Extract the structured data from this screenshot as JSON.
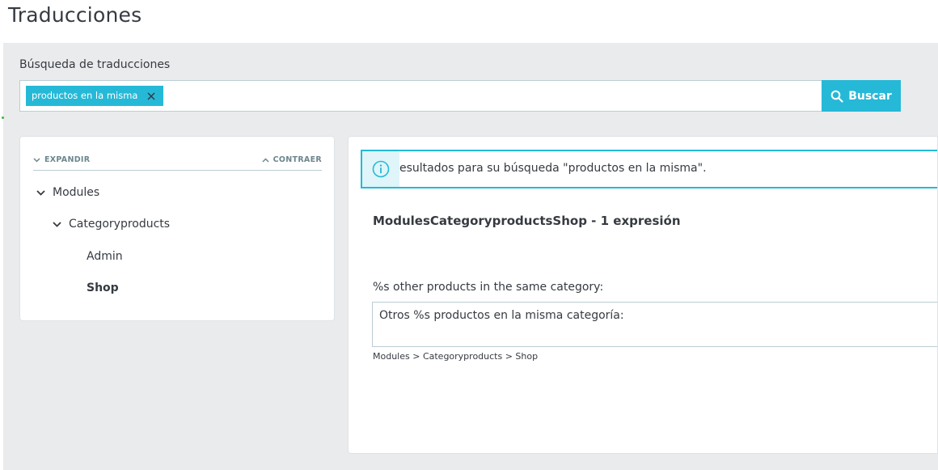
{
  "page": {
    "title": "Traducciones"
  },
  "search": {
    "label": "Búsqueda de traducciones",
    "tag": "productos en la misma",
    "button_label": "Buscar"
  },
  "tree": {
    "expand_label": "EXPANDIR",
    "collapse_label": "CONTRAER",
    "items": [
      {
        "label": "Modules"
      },
      {
        "label": "Categoryproducts"
      },
      {
        "label": "Admin"
      },
      {
        "label": "Shop"
      }
    ]
  },
  "results": {
    "alert_text": "esultados para su búsqueda \"productos en la misma\".",
    "domain_title": "ModulesCategoryproductsShop - 1 expresión",
    "source_label": "%s other products in the same category:",
    "translation_value": "Otros %s productos en la misma categoría:",
    "breadcrumb": "Modules > Categoryproducts > Shop"
  },
  "colors": {
    "accent": "#25b9d7",
    "background": "#eaebec",
    "text": "#363a41",
    "muted": "#6c868e"
  }
}
